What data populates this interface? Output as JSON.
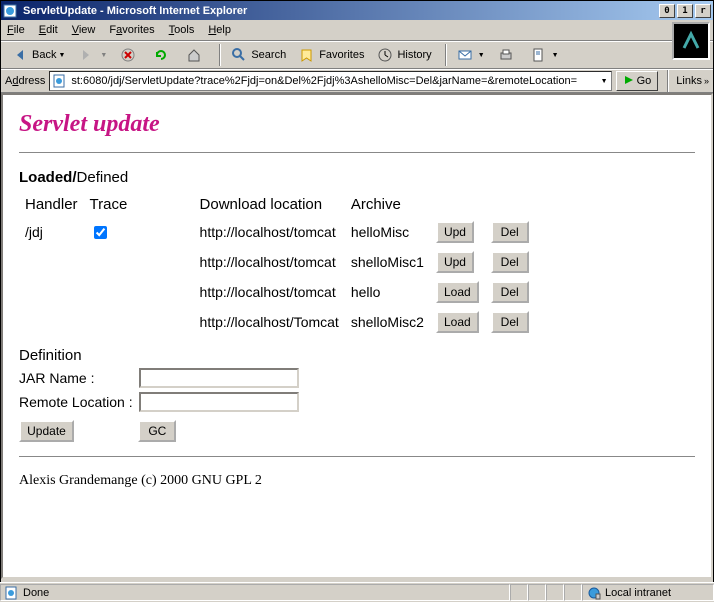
{
  "window": {
    "title": "ServletUpdate - Microsoft Internet Explorer"
  },
  "menu": {
    "file": "File",
    "edit": "Edit",
    "view": "View",
    "favorites": "Favorites",
    "tools": "Tools",
    "help": "Help"
  },
  "toolbar": {
    "back": "Back",
    "search": "Search",
    "favorites": "Favorites",
    "history": "History"
  },
  "address": {
    "label": "Address",
    "url": "st:6080/jdj/ServletUpdate?trace%2Fjdj=on&Del%2Fjdj%3AshelloMisc=Del&jarName=&remoteLocation=",
    "go": "Go",
    "links": "Links"
  },
  "page": {
    "title": "Servlet update",
    "loaded": "Loaded/",
    "defined": "Defined",
    "headers": {
      "handler": "Handler",
      "trace": "Trace",
      "download": "Download location",
      "archive": "Archive"
    },
    "rows": [
      {
        "handler": "/jdj",
        "trace": true,
        "download": "http://localhost/tomcat",
        "archive": "helloMisc",
        "btn1": "Upd",
        "btn2": "Del",
        "bold": true
      },
      {
        "handler": "",
        "trace": null,
        "download": "http://localhost/tomcat",
        "archive": "shelloMisc1",
        "btn1": "Upd",
        "btn2": "Del",
        "bold": true
      },
      {
        "handler": "",
        "trace": null,
        "download": "http://localhost/tomcat",
        "archive": "hello",
        "btn1": "Load",
        "btn2": "Del",
        "bold": false
      },
      {
        "handler": "",
        "trace": null,
        "download": "http://localhost/Tomcat",
        "archive": "shelloMisc2",
        "btn1": "Load",
        "btn2": "Del",
        "bold": false
      }
    ],
    "definition": {
      "heading": "Definition",
      "jar_label": "JAR Name :",
      "remote_label": "Remote Location :",
      "jar_value": "",
      "remote_value": "",
      "update_btn": "Update",
      "gc_btn": "GC"
    },
    "footer": "Alexis Grandemange (c) 2000 GNU GPL 2"
  },
  "status": {
    "done": "Done",
    "zone": "Local intranet"
  }
}
